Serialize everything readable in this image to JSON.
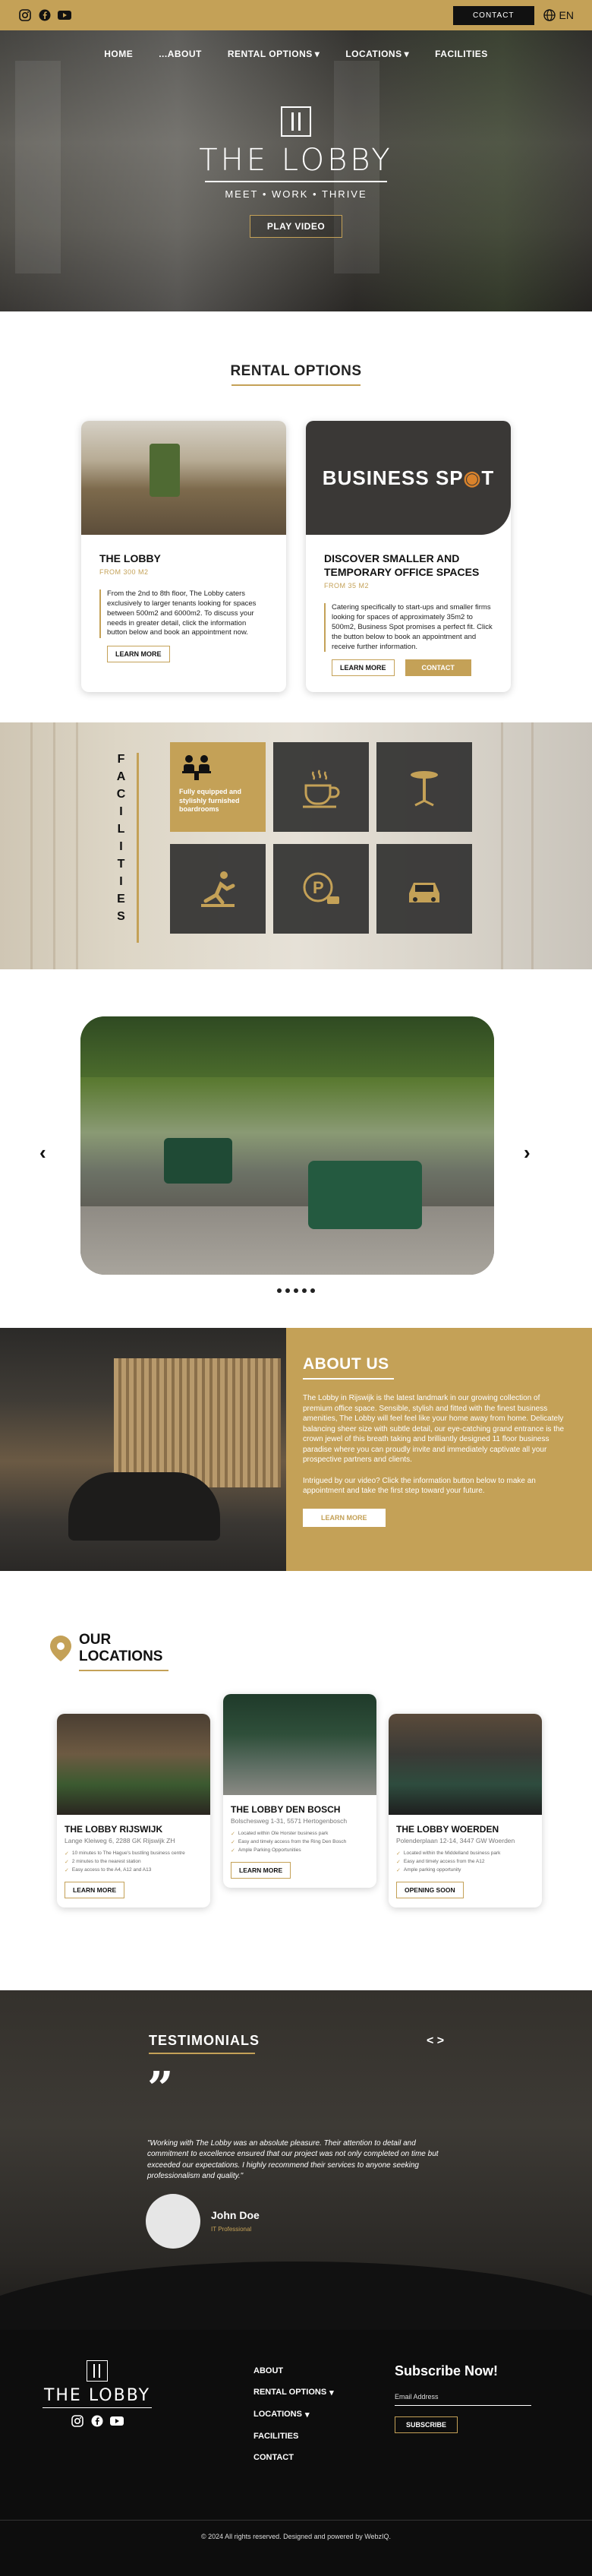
{
  "topbar": {
    "contact_label": "CONTACT",
    "language": "EN",
    "social": [
      "instagram-icon",
      "facebook-icon",
      "youtube-icon"
    ]
  },
  "nav": {
    "items": [
      {
        "label": "HOME",
        "dropdown": false
      },
      {
        "label": "...ABOUT",
        "dropdown": false
      },
      {
        "label": "RENTAL OPTIONS",
        "dropdown": true
      },
      {
        "label": "LOCATIONS",
        "dropdown": true
      },
      {
        "label": "FACILITIES",
        "dropdown": false
      }
    ]
  },
  "hero": {
    "title": "THE LOBBY",
    "subtitle": "MEET • WORK • THRIVE",
    "button": "PLAY VIDEO"
  },
  "rental": {
    "title": "RENTAL OPTIONS",
    "cards": [
      {
        "title": "THE LOBBY",
        "from": "FROM 300 M2",
        "desc": "From the 2nd to 8th floor, The Lobby caters exclusively to larger tenants looking for spaces between 500m2 and 6000m2.  To discuss your needs in greater detail, click the information button below and book an appointment now.",
        "btn_more": "LEARN MORE"
      },
      {
        "title": "DISCOVER SMALLER AND TEMPORARY OFFICE SPACES",
        "from": "FROM 35 M2",
        "banner_text_1": "BUSINESS SP",
        "banner_text_2": "T",
        "desc": "Catering specifically to start-ups and smaller firms looking for spaces of approximately 35m2 to 500m2, Business Spot promises a perfect fit. Click the button below to book an appointment and receive further information.",
        "btn_more": "LEARN MORE",
        "btn_contact": "CONTACT"
      }
    ]
  },
  "facilities": {
    "label": "FACILITIES",
    "tiles": [
      {
        "icon": "meeting-icon",
        "caption": "Fully equipped and stylishly furnished boardrooms"
      },
      {
        "icon": "coffee-icon"
      },
      {
        "icon": "table-icon"
      },
      {
        "icon": "gym-icon"
      },
      {
        "icon": "parking-icon"
      },
      {
        "icon": "car-icon"
      }
    ]
  },
  "carousel": {
    "prev": "‹",
    "next": "›",
    "dots": 5
  },
  "about": {
    "title": "ABOUT US",
    "p1": "The Lobby in Rijswijk is the latest landmark in our growing collection of premium office space. Sensible, stylish and fitted with the finest business amenities, The Lobby will feel feel like your home away from home. Delicately balancing sheer size with subtle detail, our eye-catching grand entrance is the crown jewel of this breath taking and brilliantly designed 11 floor business paradise where you can proudly invite and immediately captivate all your prospective partners and clients.",
    "p2": "Intrigued by our video? Click the information button below to make an appointment and take the first step toward your future.",
    "button": "LEARN MORE"
  },
  "locations": {
    "title_1": "OUR",
    "title_2": "LOCATIONS",
    "cards": [
      {
        "title": "THE LOBBY RIJSWIJK",
        "addr": "Lange Kleiweg 6, 2288 GK Rijswijk ZH",
        "features": [
          "10 minutes to The Hague's bustling business centre",
          "2 minutes to the nearest station",
          "Easy access to the A4, A12 and A13"
        ],
        "button": "LEARN MORE"
      },
      {
        "title": "THE LOBBY DEN BOSCH",
        "addr": "Bolschesweg 1-31, 5571 Hertogenbosch",
        "features": [
          "Located within Ole Horster business park",
          "Easy and timely access from the Ring Den Bosch",
          "Ample Parking Opportunities"
        ],
        "button": "LEARN MORE"
      },
      {
        "title": "THE LOBBY WOERDEN",
        "addr": "Polenderplaan 12-14, 3447 GW Woerden",
        "features": [
          "Located within the Middelland business park",
          "Easy and timely access from the A12",
          "Ample parking opportunity"
        ],
        "button": "OPENING SOON"
      }
    ]
  },
  "testimonials": {
    "title": "TESTIMONIALS",
    "quote": "\"Working with The Lobby was an absolute pleasure. Their attention to detail and commitment to excellence ensured that our project was not only completed on time but exceeded our expectations. I highly recommend their services to anyone seeking professionalism and quality.\"",
    "name": "John Doe",
    "role": "IT Professional",
    "nav": "< >"
  },
  "footer": {
    "logo": "THE LOBBY",
    "links": [
      {
        "label": "ABOUT",
        "dropdown": false
      },
      {
        "label": "RENTAL OPTIONS",
        "dropdown": true
      },
      {
        "label": "LOCATIONS",
        "dropdown": true
      },
      {
        "label": "FACILITIES",
        "dropdown": false
      },
      {
        "label": "CONTACT",
        "dropdown": false
      }
    ],
    "subscribe_title": "Subscribe Now!",
    "email_placeholder": "Email Address",
    "subscribe_button": "SUBSCRIBE",
    "copyright": "© 2024 All rights reserved. Designed and powered by WebzIQ."
  }
}
